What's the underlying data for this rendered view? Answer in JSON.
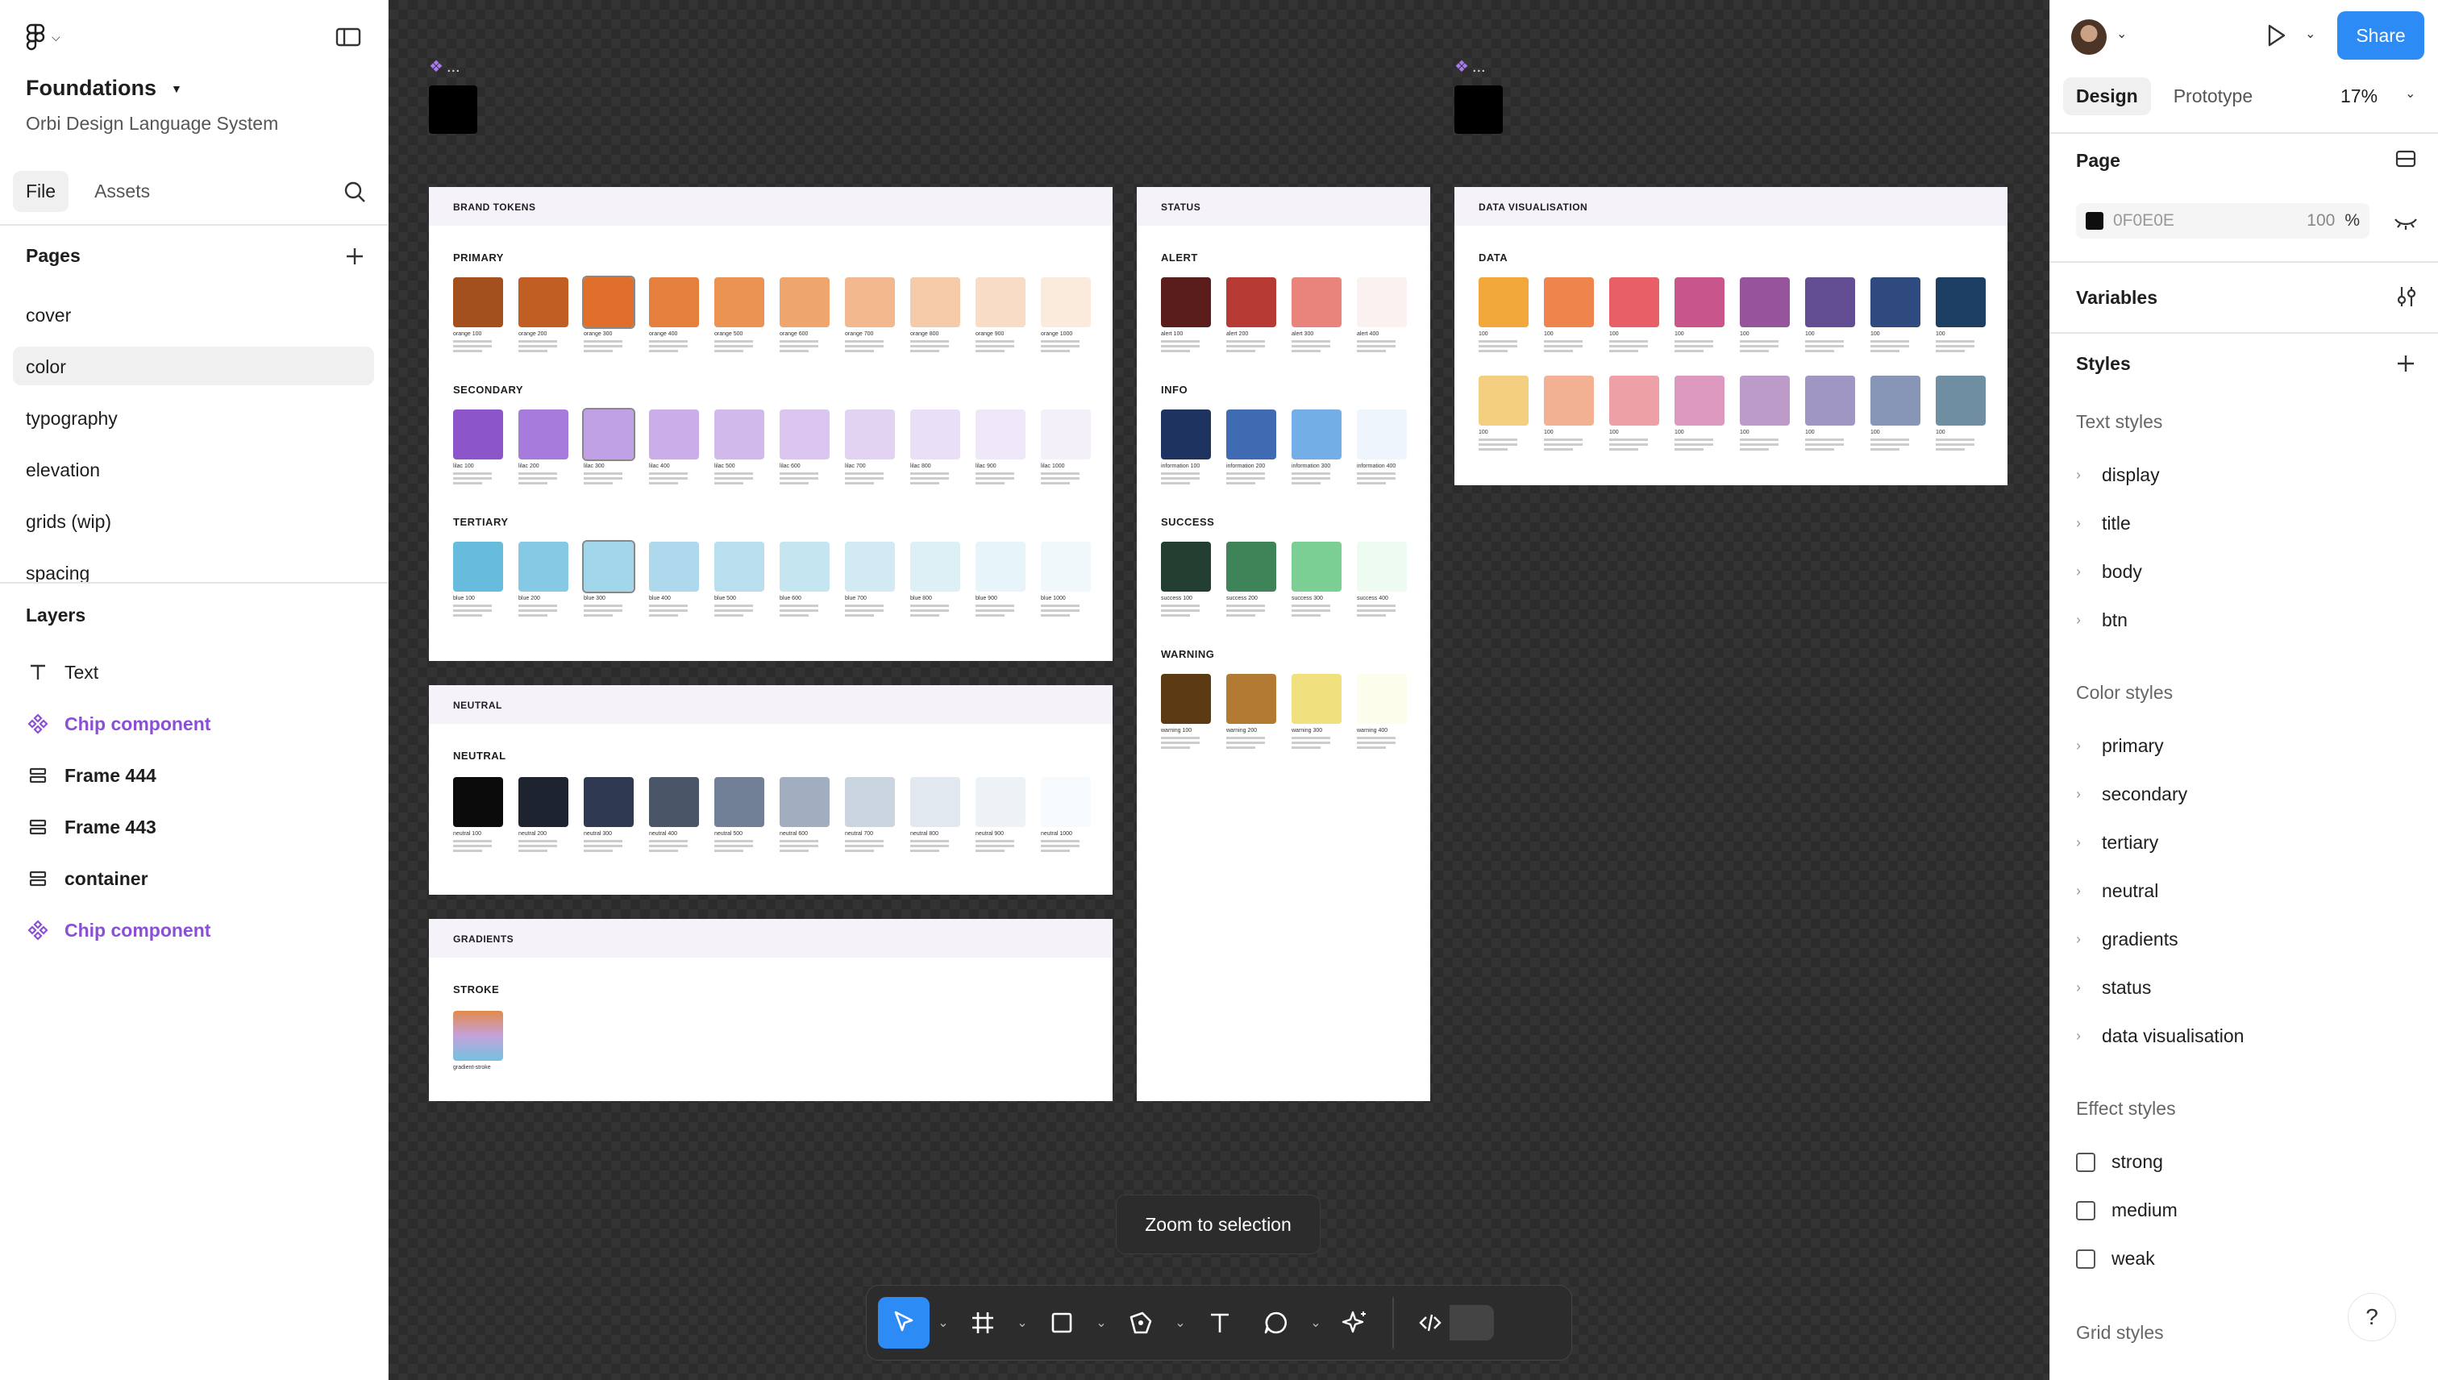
{
  "left_panel": {
    "file_name": "Foundations",
    "file_subtitle": "Orbi Design Language System",
    "tabs": [
      "File",
      "Assets"
    ],
    "pages_title": "Pages",
    "pages": [
      "cover",
      "color",
      "typography",
      "elevation",
      "grids (wip)",
      "spacing"
    ],
    "active_page": "color",
    "layers_title": "Layers",
    "layers": [
      {
        "label": "Text",
        "kind": "text"
      },
      {
        "label": "Chip component",
        "kind": "component"
      },
      {
        "label": "Frame 444",
        "kind": "frame"
      },
      {
        "label": "Frame 443",
        "kind": "frame"
      },
      {
        "label": "container",
        "kind": "frame"
      },
      {
        "label": "Chip component",
        "kind": "component"
      }
    ]
  },
  "canvas": {
    "brand_tokens": {
      "header": "BRAND TOKENS",
      "groups": [
        {
          "title": "PRIMARY",
          "names": [
            "orange 100",
            "orange 200",
            "orange 300",
            "orange 400",
            "orange 500",
            "orange 600",
            "orange 700",
            "orange 800",
            "orange 900",
            "orange 1000"
          ],
          "colors": [
            "#a3501e",
            "#c05e23",
            "#e16f2c",
            "#e47f3e",
            "#eb9352",
            "#eea56e",
            "#f2b88e",
            "#f5cba9",
            "#f8dcc6",
            "#fbebdd"
          ]
        },
        {
          "title": "SECONDARY",
          "names": [
            "lilac 100",
            "lilac 200",
            "lilac 300",
            "lilac 400",
            "lilac 500",
            "lilac 600",
            "lilac 700",
            "lilac 800",
            "lilac 900",
            "lilac 1000"
          ],
          "colors": [
            "#8c55c9",
            "#a77bdb",
            "#c0a1e6",
            "#cbaee9",
            "#d2b9ec",
            "#dac6ef",
            "#e2d3f3",
            "#e9dff6",
            "#efe8f8",
            "#f4f0fa"
          ]
        },
        {
          "title": "TERTIARY",
          "names": [
            "blue 100",
            "blue 200",
            "blue 300",
            "blue 400",
            "blue 500",
            "blue 600",
            "blue 700",
            "blue 800",
            "blue 900",
            "blue 1000"
          ],
          "colors": [
            "#67bcde",
            "#85c9e4",
            "#a2d6ea",
            "#aed9ec",
            "#b9dfee",
            "#c5e5f1",
            "#d1eaf4",
            "#ddf0f6",
            "#e7f4f9",
            "#f1f8fb"
          ]
        }
      ]
    },
    "neutral": {
      "header": "NEUTRAL",
      "title": "NEUTRAL",
      "names": [
        "neutral 100",
        "neutral 200",
        "neutral 300",
        "neutral 400",
        "neutral 500",
        "neutral 600",
        "neutral 700",
        "neutral 800",
        "neutral 900",
        "neutral 1000"
      ],
      "colors": [
        "#0b0b0c",
        "#1e2330",
        "#2f3a52",
        "#4a5568",
        "#718096",
        "#a0aec0",
        "#cbd5e0",
        "#e2e8f0",
        "#edf2f7",
        "#f7fafc"
      ]
    },
    "gradients": {
      "header": "GRADIENTS",
      "title": "STROKE",
      "name": "gradient-stroke"
    },
    "status": {
      "header": "STATUS",
      "groups": [
        {
          "title": "ALERT",
          "names": [
            "alert 100",
            "alert 200",
            "alert 300",
            "alert 400"
          ],
          "colors": [
            "#5b1c1c",
            "#b83a34",
            "#e8847c",
            "#fbf1f0"
          ]
        },
        {
          "title": "INFO",
          "names": [
            "information 100",
            "information 200",
            "information 300",
            "information 400"
          ],
          "colors": [
            "#1f3360",
            "#3f6bb3",
            "#74aee6",
            "#eef5fd"
          ]
        },
        {
          "title": "SUCCESS",
          "names": [
            "success 100",
            "success 200",
            "success 300",
            "success 400"
          ],
          "colors": [
            "#233f31",
            "#3e8458",
            "#7ccf94",
            "#eefbf1"
          ]
        },
        {
          "title": "WARNING",
          "names": [
            "warning 100",
            "warning 200",
            "warning 300",
            "warning 400"
          ],
          "colors": [
            "#5c3a14",
            "#b27a33",
            "#f0e07e",
            "#fdfdec"
          ]
        }
      ]
    },
    "data_viz": {
      "header": "DATA VISUALISATION",
      "title": "DATA",
      "row1": [
        "#f1a73a",
        "#ef844c",
        "#e85f67",
        "#c9568b",
        "#96549c",
        "#644e93",
        "#2f4a7f",
        "#1d3f63"
      ],
      "row2": [
        "#f4cf7f",
        "#f3b193",
        "#eda0a6",
        "#dc98bd",
        "#bc9bc9",
        "#9f96c3",
        "#8796b6",
        "#6f8ea1"
      ],
      "labels": [
        "100",
        "100",
        "100",
        "100",
        "100",
        "100",
        "100",
        "100"
      ]
    }
  },
  "toast": "Zoom to selection",
  "right_panel": {
    "share_label": "Share",
    "tabs": [
      "Design",
      "Prototype"
    ],
    "zoom": "17%",
    "page_title": "Page",
    "page_fill_hex": "0F0E0E",
    "page_fill_opacity": "100",
    "page_fill_unit": "%",
    "variables_title": "Variables",
    "styles_title": "Styles",
    "text_styles_title": "Text styles",
    "text_styles": [
      "display",
      "title",
      "body",
      "btn"
    ],
    "color_styles_title": "Color styles",
    "color_styles": [
      "primary",
      "secondary",
      "tertiary",
      "neutral",
      "gradients",
      "status",
      "data visualisation"
    ],
    "effect_styles_title": "Effect styles",
    "effect_styles": [
      "strong",
      "medium",
      "weak"
    ],
    "grid_styles_title": "Grid styles",
    "help": "?"
  }
}
